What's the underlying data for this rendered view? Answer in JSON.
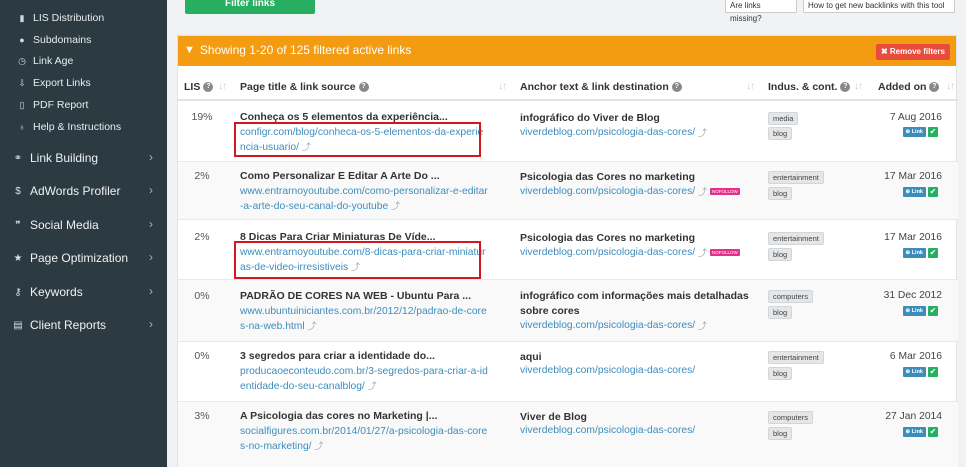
{
  "sidebar": {
    "sub_items": [
      {
        "label": "LIS Distribution",
        "icon": "bar-chart-icon",
        "glyph": "▮"
      },
      {
        "label": "Subdomains",
        "icon": "globe-icon",
        "glyph": "●"
      },
      {
        "label": "Link Age",
        "icon": "clock-icon",
        "glyph": "◷"
      },
      {
        "label": "Export Links",
        "icon": "download-icon",
        "glyph": "⇩"
      },
      {
        "label": "PDF Report",
        "icon": "file-icon",
        "glyph": "▯"
      },
      {
        "label": "Help & Instructions",
        "icon": "lightbulb-icon",
        "glyph": "♁"
      }
    ],
    "main_items": [
      {
        "label": "Link Building",
        "icon": "link-icon",
        "glyph": "⚭",
        "chevron": "›"
      },
      {
        "label": "AdWords Profiler",
        "icon": "dollar-icon",
        "glyph": "$",
        "chevron": "›"
      },
      {
        "label": "Social Media",
        "icon": "comments-icon",
        "glyph": "❞",
        "chevron": "›"
      },
      {
        "label": "Page Optimization",
        "icon": "star-icon",
        "glyph": "★",
        "chevron": "›"
      },
      {
        "label": "Keywords",
        "icon": "key-icon",
        "glyph": "⚷",
        "chevron": "›"
      },
      {
        "label": "Client Reports",
        "icon": "report-icon",
        "glyph": "▤",
        "chevron": "›"
      }
    ]
  },
  "toolbar": {
    "filter_label": "Filter links",
    "missing_label": "Are links missing?",
    "howto_label": "How to get new backlinks with this tool"
  },
  "panel": {
    "title": "Showing 1-20 of 125 filtered active links",
    "remove_label": "✖ Remove filters"
  },
  "columns": {
    "lis": "LIS",
    "page": "Page title & link source",
    "anchor": "Anchor text & link destination",
    "industry": "Indus. & cont.",
    "added": "Added on"
  },
  "badges": {
    "link": "⊕ Link",
    "check": "✔",
    "nofollow": "NOFOLLOW",
    "ext": "⤴"
  },
  "rows": [
    {
      "lis": "19%",
      "title": "Conheça os 5 elementos da experiência...",
      "url": "configr.com/blog/conheca-os-5-elementos-da-experiencia-usuario/",
      "anchor": "infográfico do Viver de Blog",
      "dest": "viverdeblog.com/psicologia-das-cores/",
      "tag1": "media",
      "tag2": "blog",
      "date": "7 Aug 2016"
    },
    {
      "lis": "2%",
      "title": "Como Personalizar E Editar A Arte Do ...",
      "url": "www.entrarnoyoutube.com/como-personalizar-e-editar-a-arte-do-seu-canal-do-youtube",
      "anchor": "Psicologia das Cores no marketing",
      "dest": "viverdeblog.com/psicologia-das-cores/",
      "tag1": "entertainment",
      "tag2": "blog",
      "date": "17 Mar 2016"
    },
    {
      "lis": "2%",
      "title": "8 Dicas Para Criar Miniaturas De Víde...",
      "url": "www.entrarnoyoutube.com/8-dicas-para-criar-miniaturas-de-video-irresistiveis",
      "anchor": "Psicologia das Cores no marketing",
      "dest": "viverdeblog.com/psicologia-das-cores/",
      "tag1": "entertainment",
      "tag2": "blog",
      "date": "17 Mar 2016"
    },
    {
      "lis": "0%",
      "title": "PADRÃO DE CORES NA WEB - Ubuntu Para ...",
      "url": "www.ubuntuiniciantes.com.br/2012/12/padrao-de-cores-na-web.html",
      "anchor": "infográfico com informações mais detalhadas sobre cores",
      "dest": "viverdeblog.com/psicologia-das-cores/",
      "tag1": "computers",
      "tag2": "blog",
      "date": "31 Dec 2012"
    },
    {
      "lis": "0%",
      "title": "3 segredos para criar a identidade do...",
      "url": "producaoeconteudo.com.br/3-segredos-para-criar-a-identidade-do-seu-canalblog/",
      "anchor": "aqui",
      "dest": "viverdeblog.com/psicologia-das-cores/",
      "tag1": "entertainment",
      "tag2": "blog",
      "date": "6 Mar 2016"
    },
    {
      "lis": "3%",
      "title": "A Psicologia das cores no Marketing |...",
      "url": "socialfigures.com.br/2014/01/27/a-psicologia-das-cores-no-marketing/",
      "anchor": "Viver de Blog",
      "dest": "viverdeblog.com/psicologia-das-cores/",
      "tag1": "computers",
      "tag2": "blog",
      "date": "27 Jan 2014"
    }
  ],
  "colors": {
    "accent": "#f39c12",
    "sidebar": "#2c3b41",
    "link": "#3c8dbc",
    "success": "#27ae60",
    "danger": "#e74c3c",
    "highlight": "#d01820"
  }
}
